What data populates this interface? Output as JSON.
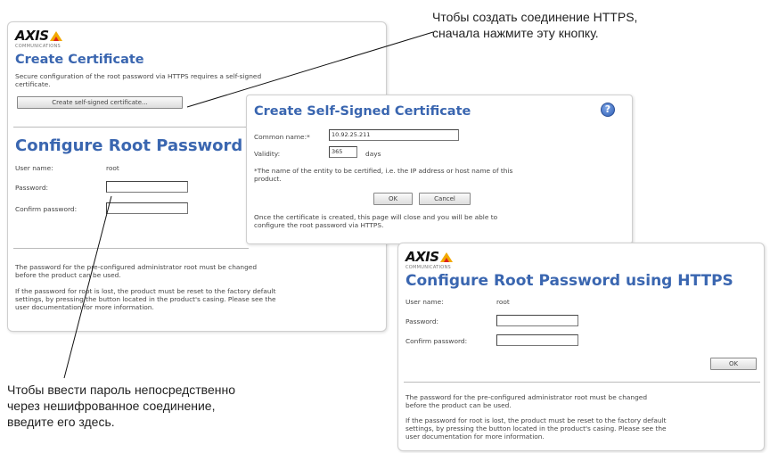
{
  "callouts": {
    "https": [
      "Чтобы создать соединение HTTPS,",
      "сначала нажмите эту кнопку."
    ],
    "direct": [
      "Чтобы ввести пароль непосредственно",
      "через нешифрованное соединение,",
      "введите его здесь."
    ]
  },
  "brand": {
    "logo": "AXIS",
    "tagline": "COMMUNICATIONS"
  },
  "main_panel": {
    "cert_title": "Create Certificate",
    "cert_desc": [
      "Secure configuration of the root password via HTTPS requires a self-signed",
      "certificate."
    ],
    "create_cert_button": "Create self-signed certificate...",
    "root_title": "Configure Root Password",
    "username_label": "User name:",
    "username_value": "root",
    "password_label": "Password:",
    "confirm_label": "Confirm password:",
    "note1": [
      "The password for the pre-configured administrator root must be changed",
      "before the product can be used."
    ],
    "note2": [
      "If the password for root is lost, the product must be reset to the factory default",
      "settings, by pressing the button located in the product's casing. Please see the",
      "user documentation for more information."
    ]
  },
  "dialog": {
    "title": "Create Self-Signed Certificate",
    "common_name_label": "Common name:*",
    "common_name_value": "10.92.25.211",
    "validity_label": "Validity:",
    "validity_value": "365",
    "validity_unit": "days",
    "footnote": [
      "*The name of the entity to be certified, i.e. the IP address or host name of this",
      "product."
    ],
    "ok_button": "OK",
    "cancel_button": "Cancel",
    "info": [
      "Once the certificate is created, this page will close and you will be able to",
      "configure the root password via HTTPS."
    ],
    "help_icon": "?"
  },
  "https_panel": {
    "title": "Configure Root Password using HTTPS",
    "username_label": "User name:",
    "username_value": "root",
    "password_label": "Password:",
    "confirm_label": "Confirm password:",
    "ok_button": "OK",
    "note1": [
      "The password for the pre-configured administrator root must be changed",
      "before the product can be used."
    ],
    "note2": [
      "If the password for root is lost, the product must be reset to the factory default",
      "settings, by pressing the button located in the product's casing. Please see the",
      "user documentation for more information."
    ]
  }
}
